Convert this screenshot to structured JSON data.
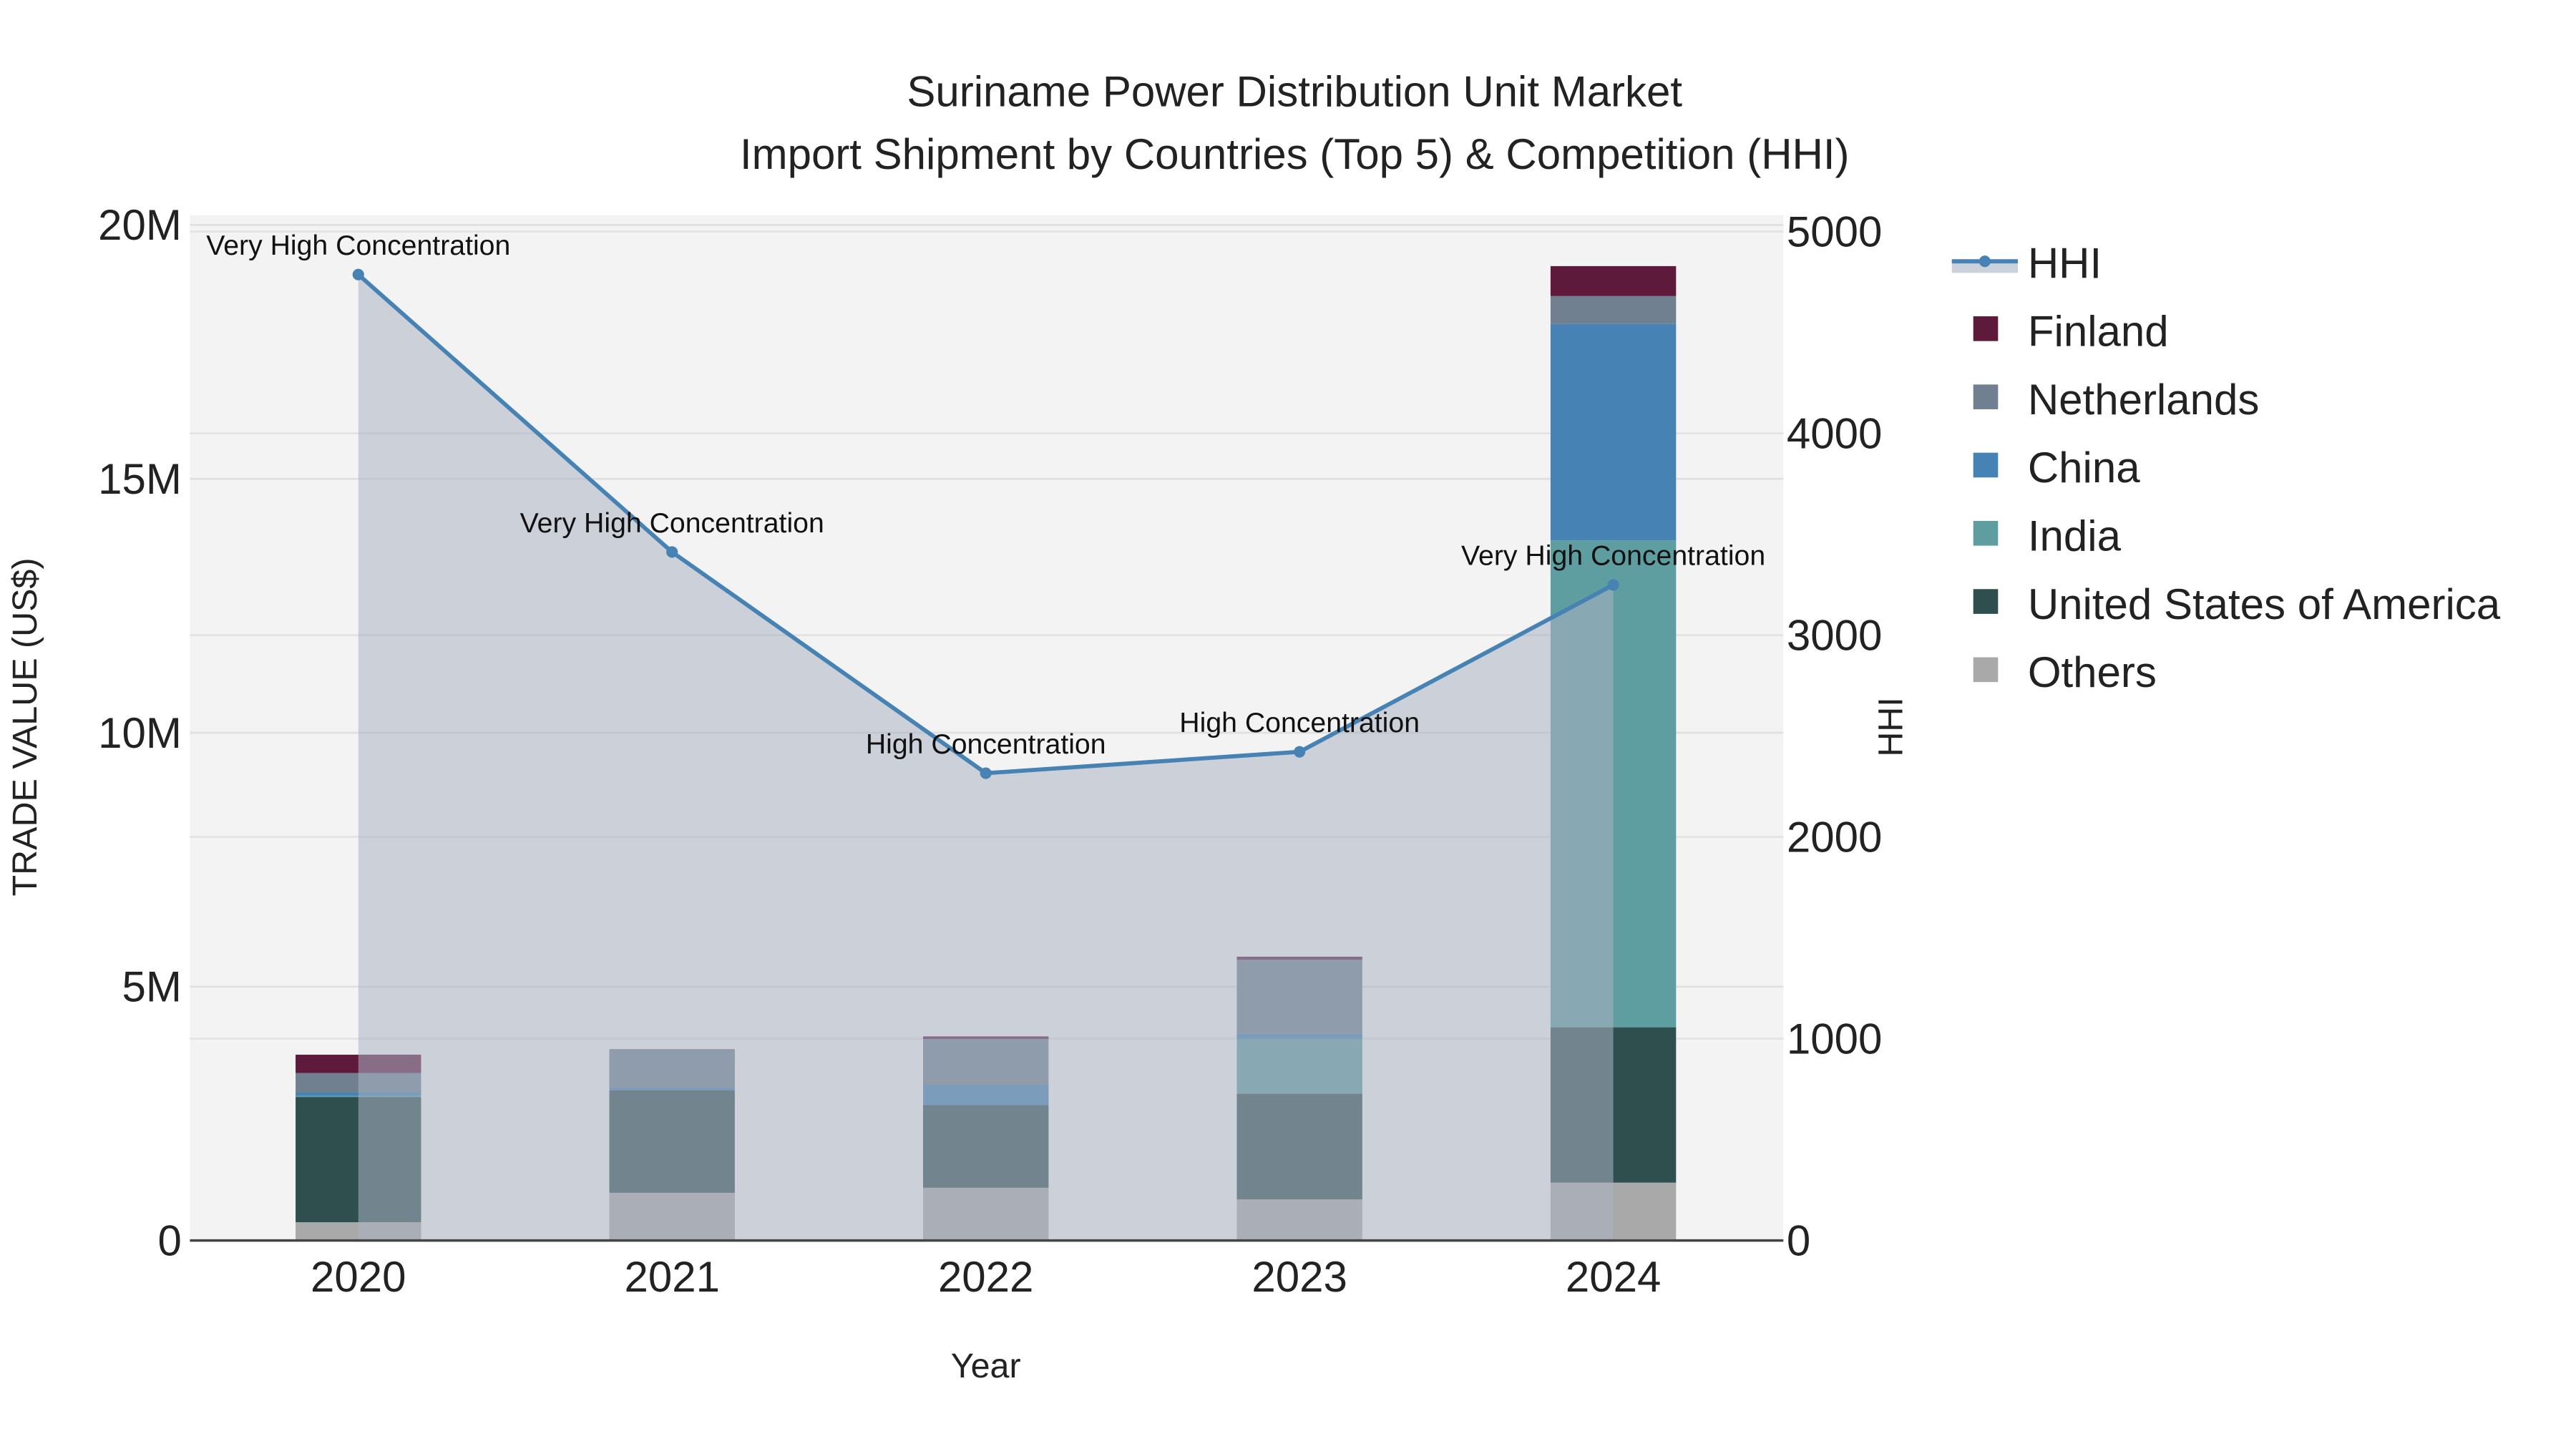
{
  "chart_data": {
    "type": "bar",
    "title": "Suriname Power Distribution Unit Market",
    "subtitle": "Import Shipment by Countries (Top 5) & Competition (HHI)",
    "xlabel": "Year",
    "ylabel": "TRADE VALUE (US$)",
    "y2label": "HHI",
    "categories": [
      "2020",
      "2021",
      "2022",
      "2023",
      "2024"
    ],
    "ylim": [
      0,
      20000000
    ],
    "y2lim": [
      0,
      5000
    ],
    "yticks": [
      {
        "v": 0,
        "label": "0"
      },
      {
        "v": 5000000,
        "label": "5M"
      },
      {
        "v": 10000000,
        "label": "10M"
      },
      {
        "v": 15000000,
        "label": "15M"
      },
      {
        "v": 20000000,
        "label": "20M"
      }
    ],
    "y2ticks": [
      {
        "v": 0,
        "label": "0"
      },
      {
        "v": 1000,
        "label": "1000"
      },
      {
        "v": 2000,
        "label": "2000"
      },
      {
        "v": 3000,
        "label": "3000"
      },
      {
        "v": 4000,
        "label": "4000"
      },
      {
        "v": 5000,
        "label": "5000"
      }
    ],
    "series": [
      {
        "name": "Others",
        "color": "#a9a9a9",
        "values": [
          360000,
          940000,
          1040000,
          810000,
          1140000
        ]
      },
      {
        "name": "United States of America",
        "color": "#2f4f4f",
        "values": [
          2470000,
          2020000,
          1630000,
          2080000,
          3060000
        ]
      },
      {
        "name": "India",
        "color": "#5f9ea0",
        "values": [
          20000,
          0,
          0,
          1080000,
          9590000
        ]
      },
      {
        "name": "China",
        "color": "#4682b4",
        "values": [
          70000,
          50000,
          390000,
          100000,
          4260000
        ]
      },
      {
        "name": "Netherlands",
        "color": "#708090",
        "values": [
          380000,
          760000,
          910000,
          1460000,
          550000
        ]
      },
      {
        "name": "Finland",
        "color": "#5e1a3a",
        "values": [
          360000,
          0,
          50000,
          60000,
          590000
        ]
      }
    ],
    "hhi": {
      "name": "HHI",
      "color": "#4682b4",
      "values": [
        4787,
        3412,
        2316,
        2422,
        3249
      ],
      "annotations": [
        "Very High Concentration",
        "Very High Concentration",
        "High Concentration",
        "High Concentration",
        "Very High Concentration"
      ]
    },
    "legend": [
      "HHI",
      "Finland",
      "Netherlands",
      "China",
      "India",
      "United States of America",
      "Others"
    ],
    "legend_placement": "right",
    "grid": true
  }
}
